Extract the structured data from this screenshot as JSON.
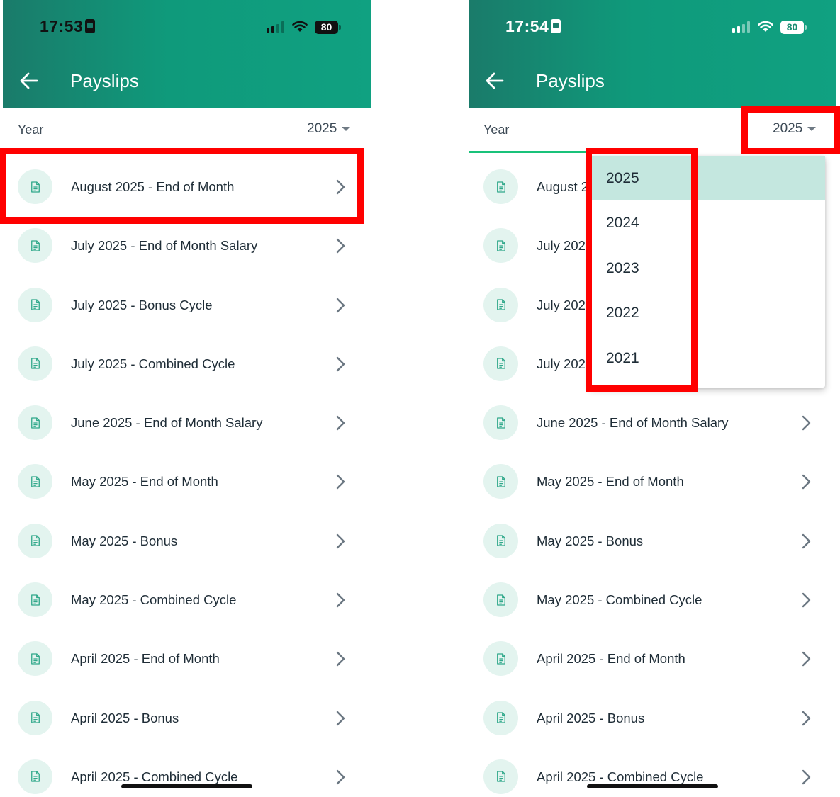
{
  "left_screen": {
    "status_bar": {
      "time": "17:53",
      "battery": "80"
    },
    "header": {
      "title": "Payslips"
    },
    "year_filter": {
      "label": "Year",
      "selected": "2025"
    },
    "payslips": [
      "August 2025 - End of Month",
      "July 2025 - End of Month Salary",
      "July 2025 - Bonus Cycle",
      "July 2025 - Combined Cycle",
      "June 2025 - End of Month Salary",
      "May 2025 - End of Month",
      "May 2025 - Bonus",
      "May 2025 - Combined Cycle",
      "April 2025 - End of Month",
      "April 2025 - Bonus",
      "April 2025 - Combined Cycle"
    ]
  },
  "right_screen": {
    "status_bar": {
      "time": "17:54",
      "battery": "80"
    },
    "header": {
      "title": "Payslips"
    },
    "year_filter": {
      "label": "Year",
      "selected": "2025"
    },
    "payslips": [
      "August 2",
      "July 202",
      "July 202",
      "July 202",
      "June 2025 - End of Month Salary",
      "May 2025 - End of Month",
      "May 2025 - Bonus",
      "May 2025 - Combined Cycle",
      "April 2025 - End of Month",
      "April 2025 - Bonus",
      "April 2025 - Combined Cycle"
    ],
    "year_dropdown": {
      "options": [
        "2025",
        "2024",
        "2023",
        "2022",
        "2021"
      ],
      "selected": "2025"
    }
  },
  "colors": {
    "header_gradient_start": "#1a7b6a",
    "header_gradient_end": "#10a181",
    "icon_circle": "#e3f4ef",
    "icon_accent": "#2fa88a",
    "selected_option": "#c4e7df",
    "tab_underline": "#19c27a",
    "highlight": "#ff0000"
  },
  "icons": {
    "back": "arrow-left-icon",
    "document": "document-icon",
    "chevron": "chevron-right-icon",
    "caret": "caret-down-icon",
    "wifi": "wifi-icon",
    "signal": "signal-icon",
    "battery": "battery-icon"
  }
}
